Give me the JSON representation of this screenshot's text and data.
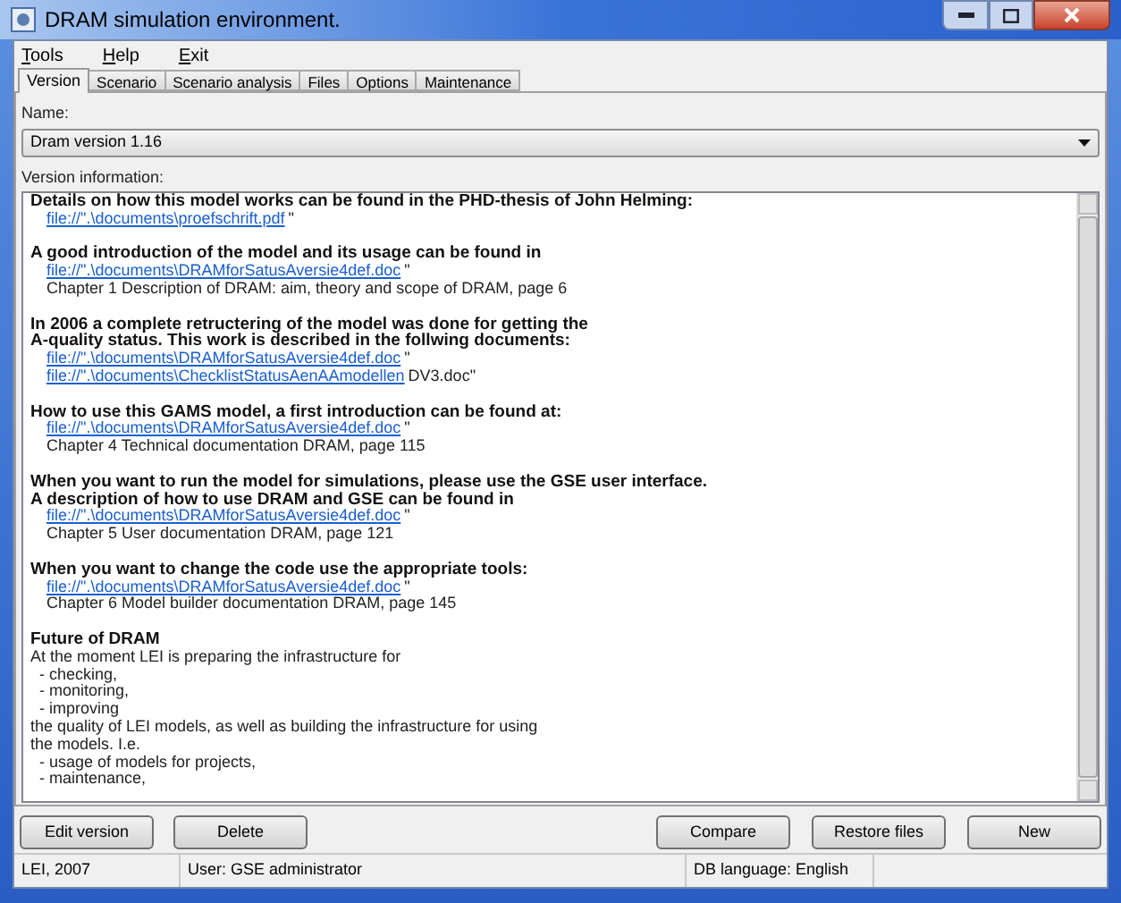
{
  "window": {
    "title": "DRAM simulation environment."
  },
  "menu": [
    {
      "label": "Tools"
    },
    {
      "label": "Help"
    },
    {
      "label": "Exit"
    }
  ],
  "tabs": [
    {
      "label": "Version",
      "selected": true
    },
    {
      "label": "Scenario",
      "selected": false
    },
    {
      "label": "Scenario analysis",
      "selected": false
    },
    {
      "label": "Files",
      "selected": false
    },
    {
      "label": "Options",
      "selected": false
    },
    {
      "label": "Maintenance",
      "selected": false
    }
  ],
  "name_label": "Name:",
  "name_select": {
    "value": "Dram version 1.16"
  },
  "info_label": "Version information:",
  "info_blocks": [
    [
      {
        "kind": "heading",
        "text": "Details on how this model works can be found in the PHD-thesis of John Helming:"
      },
      {
        "kind": "link",
        "text": "file://\".\\documents\\proefschrift.pdf",
        "suffix": "\""
      }
    ],
    [
      {
        "kind": "heading",
        "text": "A good introduction of the model and its usage can be found in"
      },
      {
        "kind": "link",
        "text": "file://\".\\documents\\DRAMforSatusAversie4def.doc",
        "suffix": "\""
      },
      {
        "kind": "text",
        "text": "Chapter 1 Description of DRAM: aim, theory and scope of DRAM, page 6"
      }
    ],
    [
      {
        "kind": "heading",
        "text": "In 2006 a complete retructering of the model was done for getting the"
      },
      {
        "kind": "heading",
        "text": "A-quality status. This work is described in the follwing documents:"
      },
      {
        "kind": "link",
        "text": "file://\".\\documents\\DRAMforSatusAversie4def.doc",
        "suffix": "\""
      },
      {
        "kind": "link",
        "text": "file://\".\\documents\\ChecklistStatusAenAAmodellen",
        "suffix": "DV3.doc\""
      }
    ],
    [
      {
        "kind": "heading",
        "text": "How to use this GAMS model, a first introduction can be found at:"
      },
      {
        "kind": "link",
        "text": "file://\".\\documents\\DRAMforSatusAversie4def.doc",
        "suffix": "\""
      },
      {
        "kind": "text",
        "text": "Chapter 4 Technical documentation DRAM, page 115"
      }
    ],
    [
      {
        "kind": "heading",
        "text": "When you want to run the model for simulations, please use the GSE user interface."
      },
      {
        "kind": "heading",
        "text": "A description of how to use DRAM and GSE can be found in"
      },
      {
        "kind": "link",
        "text": "file://\".\\documents\\DRAMforSatusAversie4def.doc",
        "suffix": "\""
      },
      {
        "kind": "text",
        "text": "Chapter 5 User documentation DRAM, page 121"
      }
    ],
    [
      {
        "kind": "heading",
        "text": "When you want to change the code use the appropriate tools:"
      },
      {
        "kind": "link",
        "text": "file://\".\\documents\\DRAMforSatusAversie4def.doc",
        "suffix": "\""
      },
      {
        "kind": "text",
        "text": "Chapter 6 Model builder documentation DRAM, page 145"
      }
    ],
    [
      {
        "kind": "heading",
        "text": "Future of DRAM"
      },
      {
        "kind": "plain",
        "text": "At the moment LEI is preparing the infrastructure for"
      },
      {
        "kind": "plain",
        "text": "  - checking,"
      },
      {
        "kind": "plain",
        "text": "  - monitoring,"
      },
      {
        "kind": "plain",
        "text": "  - improving"
      },
      {
        "kind": "plain",
        "text": "the quality of LEI models, as well as building the infrastructure for using"
      },
      {
        "kind": "plain",
        "text": "the models. I.e."
      },
      {
        "kind": "plain",
        "text": "  - usage of models for projects,"
      },
      {
        "kind": "plain",
        "text": "  - maintenance,"
      }
    ]
  ],
  "buttons_left": [
    "Edit version",
    "Delete"
  ],
  "buttons_right": [
    "Compare",
    "Restore files",
    "New"
  ],
  "status_bar": [
    "LEI, 2007",
    "User: GSE administrator",
    "DB language: English"
  ]
}
